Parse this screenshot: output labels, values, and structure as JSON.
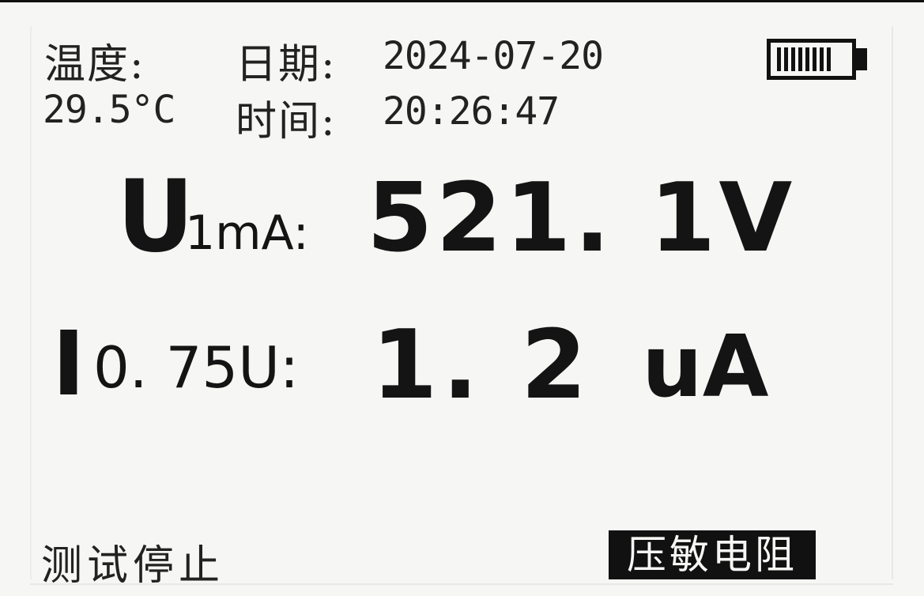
{
  "header": {
    "temperature_label": "温度:",
    "temperature_value": "29.5°C",
    "date_label": "日期:",
    "date_value": "2024-07-20",
    "time_label": "时间:",
    "time_value": "20:26:47"
  },
  "battery": {
    "icon": "battery-icon",
    "level": 1.0
  },
  "measurements": {
    "u_symbol": "U",
    "u_subscript": "1mA:",
    "u_value": "521. 1V",
    "i_symbol": "I",
    "i_subscript": "0. 75U:",
    "i_value": "1. 2",
    "i_unit": "uA"
  },
  "footer": {
    "status": "测试停止",
    "mode": "压敏电阻"
  }
}
